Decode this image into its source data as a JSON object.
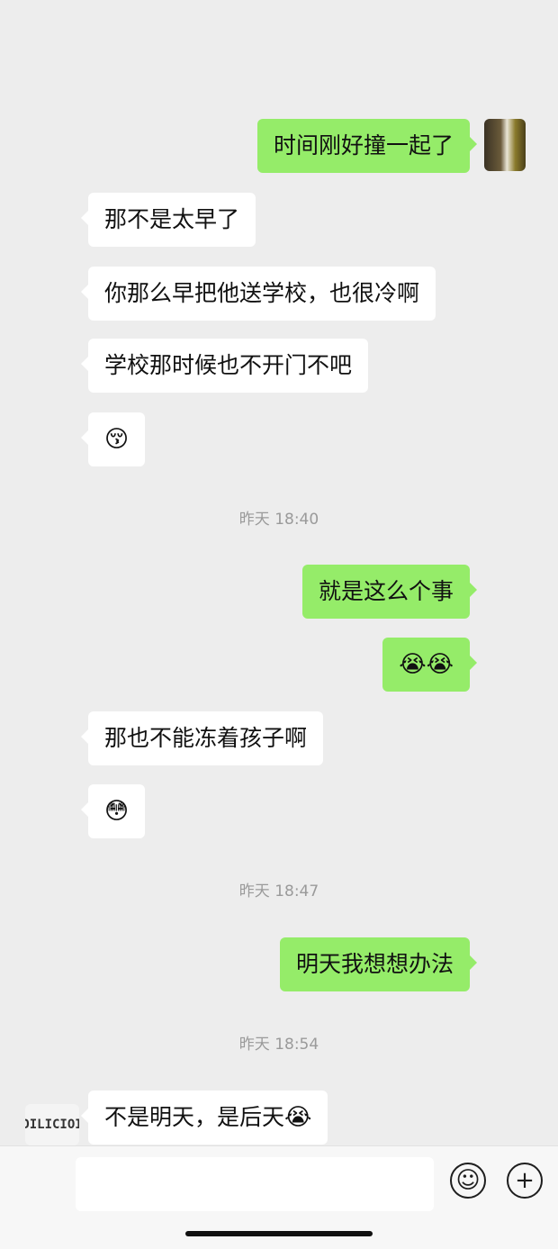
{
  "messages": [
    {
      "side": "out",
      "text": "时间刚好撞一起了"
    },
    {
      "side": "in",
      "text": "那不是太早了"
    },
    {
      "side": "in",
      "text": "你那么早把他送学校，也很冷啊"
    },
    {
      "side": "in",
      "text": "学校那时候也不开门不吧"
    },
    {
      "side": "in",
      "emoji": "😚"
    },
    {
      "side": "out",
      "text": "就是这么个事"
    },
    {
      "side": "out",
      "emoji": "😭😭"
    },
    {
      "side": "in",
      "text": "那也不能冻着孩子啊"
    },
    {
      "side": "in",
      "emoji": "😳"
    },
    {
      "side": "out",
      "text": "明天我想想办法"
    },
    {
      "side": "in",
      "text": "不是明天，是后天",
      "emoji": "😭"
    }
  ],
  "timestamps": [
    "昨天 18:40",
    "昨天 18:47",
    "昨天 18:54"
  ],
  "avatars": {
    "other_text": "DILICIOI"
  },
  "input": {
    "emoji_icon": "☺",
    "plus_icon": "+"
  }
}
